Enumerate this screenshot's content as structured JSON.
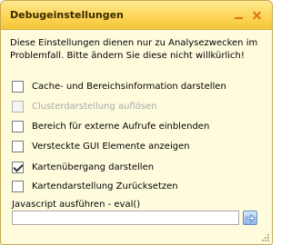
{
  "window": {
    "title": "Debugeinstellungen",
    "minimize_icon": "minimize-icon",
    "close_icon": "close-icon"
  },
  "description": "Diese Einstellungen dienen nur zu Analysezwecken im Problemfall. Bitte ändern Sie diese nicht willkürlich!",
  "options": [
    {
      "label": "Cache- und Bereichsinformation darstellen",
      "checked": false,
      "disabled": false
    },
    {
      "label": "Clusterdarstellung auflösen",
      "checked": false,
      "disabled": true
    },
    {
      "label": "Bereich für externe Aufrufe einblenden",
      "checked": false,
      "disabled": false
    },
    {
      "label": "Versteckte GUI Elemente anzeigen",
      "checked": false,
      "disabled": false
    },
    {
      "label": "Kartenübergang darstellen",
      "checked": true,
      "disabled": false
    },
    {
      "label": "Kartendarstellung Zurücksetzen",
      "checked": false,
      "disabled": false
    }
  ],
  "javascript": {
    "label": "Javascript ausführen - eval()",
    "value": "",
    "run_icon": "arrow-right-icon"
  },
  "colors": {
    "title_bar": "#fcd656",
    "panel_background": "#fffcde",
    "accent_orange": "#e2711b",
    "button_blue": "#8fb4e7"
  }
}
